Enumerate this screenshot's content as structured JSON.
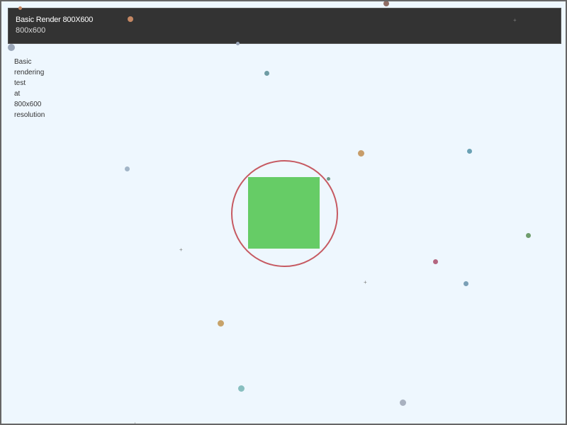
{
  "header": {
    "title": "Basic Render 800X600",
    "subtitle": "800x600"
  },
  "description": {
    "lines": [
      "Basic",
      "rendering",
      "test",
      "at",
      "800x600",
      "resolution"
    ]
  },
  "shapes": {
    "square_color": "#66cc66",
    "ring_color": "#c65a62"
  },
  "particle_colors": [
    "#9aa6b8",
    "#c48763",
    "#8f6d64",
    "#6f9ca4",
    "#c79d6a",
    "#6aa1b4",
    "#6c9a8a",
    "#a2b5c7",
    "#6f9d6d",
    "#b46680",
    "#7a9fb6",
    "#c7a36a",
    "#88bfc0",
    "#a8b1c0"
  ]
}
